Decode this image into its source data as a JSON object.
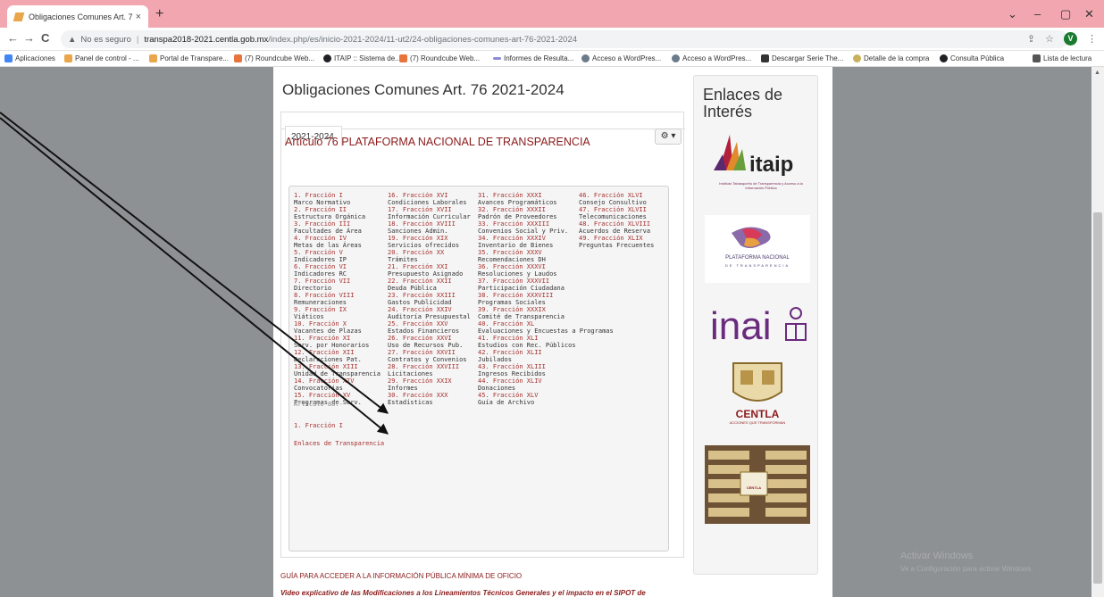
{
  "browser": {
    "tab_title": "Obligaciones Comunes Art. 76 2(",
    "tab_close": "×",
    "new_tab": "+",
    "win_controls": [
      "⌄",
      "–",
      "▢",
      "✕"
    ],
    "nav": {
      "back": "←",
      "forward": "→",
      "reload": "C"
    },
    "security_label": "No es seguro",
    "url_host": "transpa2018-2021.centla.gob.mx",
    "url_path": "/index.php/es/inicio-2021-2024/11-ut2/24-obligaciones-comunes-art-76-2021-2024",
    "profile_initial": "V"
  },
  "bookmarks": [
    {
      "label": "Aplicaciones",
      "color": "#4285f4"
    },
    {
      "label": "Panel de control - ...",
      "color": "#e9a64a"
    },
    {
      "label": "Portal de Transpare...",
      "color": "#e9a64a"
    },
    {
      "label": "(7) Roundcube Web...",
      "color": "#e8743b"
    },
    {
      "label": "ITAIP :: Sistema de...",
      "color": "#202124"
    },
    {
      "label": "(7) Roundcube Web...",
      "color": "#e8743b"
    },
    {
      "label": "Informes de Resulta...",
      "color": "#8a8ad6"
    },
    {
      "label": "Acceso a WordPres...",
      "color": "#6a7b8a"
    },
    {
      "label": "Acceso a WordPres...",
      "color": "#6a7b8a"
    },
    {
      "label": "Descargar Serie The...",
      "color": "#333333"
    },
    {
      "label": "Detalle de la compra",
      "color": "#c9b05a"
    },
    {
      "label": "Consulta Pública",
      "color": "#202124"
    }
  ],
  "reading_list": "Lista de lectura",
  "page": {
    "title": "Obligaciones Comunes Art. 76 2021-2024",
    "tab_label": "2021-2024",
    "gear_label": "⚙ ▾",
    "article_title": "Artículo 76 PLATAFORMA NACIONAL DE TRANSPARENCIA",
    "columns": [
      [
        {
          "fr": "1. Fracción I",
          "desc": "Marco Normativo"
        },
        {
          "fr": "2. Fracción II",
          "desc": "Estructura Orgánica"
        },
        {
          "fr": "3. Fracción III",
          "desc": "Facultades de Área"
        },
        {
          "fr": "4. Fracción IV",
          "desc": "Metas de las Áreas"
        },
        {
          "fr": "5. Fracción V",
          "desc": "Indicadores IP"
        },
        {
          "fr": "6. Fracción VI",
          "desc": "Indicadores RC"
        },
        {
          "fr": "7. Fracción VII",
          "desc": "Directorio"
        },
        {
          "fr": "8. Fracción VIII",
          "desc": "Remuneraciones"
        },
        {
          "fr": "9. Fracción IX",
          "desc": "Viáticos"
        },
        {
          "fr": "10. Fracción X",
          "desc": "Vacantes de Plazas"
        },
        {
          "fr": "11. Fracción XI",
          "desc": "Serv. por Honorarios"
        },
        {
          "fr": "12. Fracción XII",
          "desc": "Declaraciones Pat."
        },
        {
          "fr": "13. Fracción XIII",
          "desc": "Unidad de Transparencia"
        },
        {
          "fr": "14. Fracción XIV",
          "desc": "Convocatorias"
        },
        {
          "fr": "15. Fracción XV",
          "desc": "Programas de Serv."
        }
      ],
      [
        {
          "fr": "16. Fracción XVI",
          "desc": "Condiciones Laborales"
        },
        {
          "fr": "17. Fracción XVII",
          "desc": "Información Curricular"
        },
        {
          "fr": "18. Fracción XVIII",
          "desc": "Sanciones Admin."
        },
        {
          "fr": "19. Fracción XIX",
          "desc": "Servicios ofrecidos"
        },
        {
          "fr": "20. Fracción XX",
          "desc": "Trámites"
        },
        {
          "fr": "21. Fracción XXI",
          "desc": "Presupuesto Asignado"
        },
        {
          "fr": "22. Fracción XXII",
          "desc": "Deuda Pública"
        },
        {
          "fr": "23. Fracción XXIII",
          "desc": "Gastos Publicidad"
        },
        {
          "fr": "24. Fracción XXIV",
          "desc": "Auditoría Presupuestal"
        },
        {
          "fr": "25. Fracción XXV",
          "desc": "Estados Financieros"
        },
        {
          "fr": "26. Fracción XXVI",
          "desc": "Uso de Recursos Pub."
        },
        {
          "fr": "27. Fracción XXVII",
          "desc": "Contratos y Convenios"
        },
        {
          "fr": "28. Fracción XXVIII",
          "desc": "Licitaciones"
        },
        {
          "fr": "29. Fracción XXIX",
          "desc": "Informes"
        },
        {
          "fr": "30. Fracción XXX",
          "desc": "Estadísticas"
        }
      ],
      [
        {
          "fr": "31. Fracción XXXI",
          "desc": "Avances Programáticos"
        },
        {
          "fr": "32. Fracción XXXII",
          "desc": "Padrón de Proveedores"
        },
        {
          "fr": "33. Fracción XXXIII",
          "desc": "Convenios Social y Priv."
        },
        {
          "fr": "34. Fracción XXXIV",
          "desc": "Inventario de Bienes"
        },
        {
          "fr": "35. Fracción XXXV",
          "desc": "Recomendaciones DH"
        },
        {
          "fr": "36. Fracción XXXVI",
          "desc": "Resoluciones y Laudos"
        },
        {
          "fr": "37. Fracción XXXVII",
          "desc": "Participación Ciudadana"
        },
        {
          "fr": "38. Fracción XXXVIII",
          "desc": "Programas Sociales"
        },
        {
          "fr": "39. Fracción XXXIX",
          "desc": "Comité de Transparencia"
        },
        {
          "fr": "40. Fracción XL",
          "desc": "Evaluaciones y Encuestas a Programas"
        },
        {
          "fr": "41. Fracción XLI",
          "desc": "Estudios con Rec. Públicos"
        },
        {
          "fr": "42. Fracción XLII",
          "desc": "Jubilados"
        },
        {
          "fr": "43. Fracción XLIII",
          "desc": "Ingresos Recibidos"
        },
        {
          "fr": "44. Fracción XLIV",
          "desc": "Donaciones"
        },
        {
          "fr": "45. Fracción XLV",
          "desc": "Guía de Archivo"
        }
      ],
      [
        {
          "fr": "46. Fracción XLVI",
          "desc": "Consejo Consultivo"
        },
        {
          "fr": "47. Fracción XLVII",
          "desc": "Telecomunicaciones"
        },
        {
          "fr": "48. Fracción XLVIII",
          "desc": "Acuerdos de Reserva"
        },
        {
          "fr": "49. Fracción XLIX",
          "desc": "Preguntas Frecuentes"
        }
      ]
    ],
    "art88_label": "Artículo 88.-",
    "art88_item": "1. Fracción I",
    "enlaces_transparencia": "Enlaces de Transparencia",
    "guide_text": "GUÍA PARA ACCEDER A LA INFORMACIÓN PÚBLICA MÍNIMA DE OFICIO",
    "video_text": "Video explicativo de las Modificaciones a los Lineamientos Técnicos Generales y el impacto en el SIPOT de"
  },
  "sidebar": {
    "title": "Enlaces de Interés",
    "logos": [
      {
        "name": "itaip",
        "text": "itaip",
        "subtitle": "Instituto Tabasqueño de Transparencia y Acceso a la Información Pública"
      },
      {
        "name": "plataforma",
        "text": "PLATAFORMA NACIONAL",
        "subtitle": "DE TRANSPARENCIA"
      },
      {
        "name": "inai",
        "text": "inai"
      },
      {
        "name": "centla",
        "text": "CENTLA",
        "subtitle": "ACCIONES QUE TRANSFORMAN"
      },
      {
        "name": "archivo",
        "text": "CENTLA"
      }
    ]
  },
  "watermark": {
    "title": "Activar Windows",
    "subtitle": "Ve a Configuración para activar Windows."
  },
  "colors": {
    "link": "#a5312f",
    "tabbar": "#f2a7b0",
    "page_bg": "#8e9193"
  }
}
